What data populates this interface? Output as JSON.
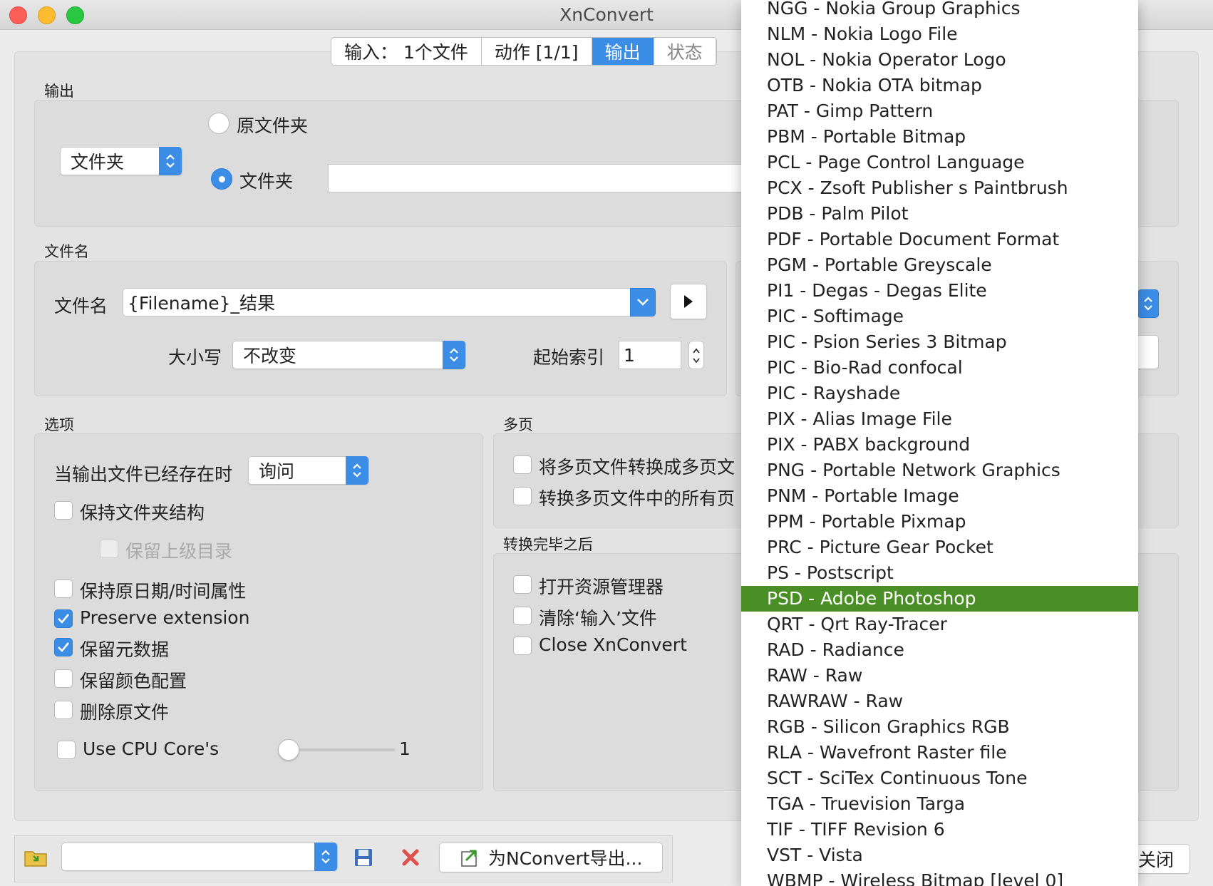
{
  "window": {
    "title": "XnConvert"
  },
  "tabs": [
    {
      "label": "输入：  1个文件",
      "state": "normal"
    },
    {
      "label": "动作 [1/1]",
      "state": "normal"
    },
    {
      "label": "输出",
      "state": "active"
    },
    {
      "label": "状态",
      "state": "inactive"
    }
  ],
  "output": {
    "section_label": "输出",
    "dest_select": "文件夹",
    "radio_original": "原文件夹",
    "radio_folder": "文件夹",
    "radio_selected": "folder",
    "folder_path": ""
  },
  "filename": {
    "section_label": "文件名",
    "label": "文件名",
    "value": "{Filename}_结果",
    "case_label": "大小写",
    "case_value": "不改变",
    "start_index_label": "起始索引",
    "start_index_value": "1"
  },
  "options": {
    "section_label": "选项",
    "exists_label": "当输出文件已经存在时",
    "exists_value": "询问",
    "checkboxes": [
      {
        "label": "保持文件夹结构",
        "checked": false,
        "disabled": false
      },
      {
        "label": "保留上级目录",
        "checked": false,
        "disabled": true
      },
      {
        "label": "保持原日期/时间属性",
        "checked": false,
        "disabled": false
      },
      {
        "label": "Preserve extension",
        "checked": true,
        "disabled": false
      },
      {
        "label": "保留元数据",
        "checked": true,
        "disabled": false
      },
      {
        "label": "保留颜色配置",
        "checked": false,
        "disabled": false
      },
      {
        "label": "删除原文件",
        "checked": false,
        "disabled": false
      }
    ],
    "cpu_label": "Use CPU Core's",
    "cpu_checked": false,
    "cpu_value": "1"
  },
  "multipage": {
    "section_label": "多页",
    "checkboxes": [
      {
        "label": "将多页文件转换成多页文",
        "checked": false
      },
      {
        "label": "转换多页文件中的所有页",
        "checked": false
      }
    ]
  },
  "after": {
    "section_label": "转换完毕之后",
    "checkboxes": [
      {
        "label": "打开资源管理器",
        "checked": false
      },
      {
        "label": "清除‘输入’文件",
        "checked": false
      },
      {
        "label": "Close XnConvert",
        "checked": false
      }
    ]
  },
  "bottom": {
    "preset_value": "",
    "export_label": "为NConvert导出...",
    "close_label": "关闭"
  },
  "format_list": {
    "selected_index": 23,
    "items": [
      "NGG - Nokia Group Graphics",
      "NLM - Nokia Logo File",
      "NOL - Nokia Operator Logo",
      "OTB - Nokia OTA bitmap",
      "PAT - Gimp Pattern",
      "PBM - Portable Bitmap",
      "PCL - Page Control Language",
      "PCX - Zsoft Publisher s Paintbrush",
      "PDB - Palm Pilot",
      "PDF - Portable Document Format",
      "PGM - Portable Greyscale",
      "PI1 - Degas - Degas Elite",
      "PIC - Softimage",
      "PIC - Psion Series 3 Bitmap",
      "PIC - Bio-Rad confocal",
      "PIC - Rayshade",
      "PIX - Alias Image File",
      "PIX - PABX background",
      "PNG - Portable Network Graphics",
      "PNM - Portable Image",
      "PPM - Portable Pixmap",
      "PRC - Picture Gear Pocket",
      "PS - Postscript",
      "PSD - Adobe Photoshop",
      "QRT - Qrt Ray-Tracer",
      "RAD - Radiance",
      "RAW - Raw",
      "RAWRAW - Raw",
      "RGB - Silicon Graphics RGB",
      "RLA - Wavefront Raster file",
      "SCT - SciTex Continuous Tone",
      "TGA - Truevision Targa",
      "TIF - TIFF Revision 6",
      "VST - Vista",
      "WBMP - Wireless Bitmap [level 0]"
    ]
  },
  "colors": {
    "accent": "#3b8de6",
    "selection": "#4a8f25"
  }
}
